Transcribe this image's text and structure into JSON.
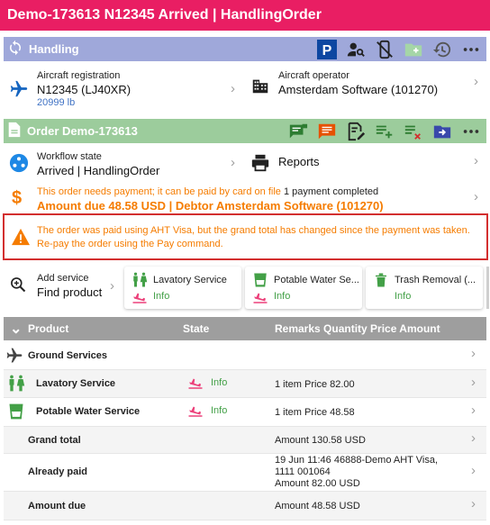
{
  "title": "Demo-173613 N12345 Arrived | HandlingOrder",
  "handling": {
    "header": "Handling",
    "aircraft_registration_label": "Aircraft registration",
    "aircraft_registration": "N12345 (LJ40XR)",
    "aircraft_weight": "20999 lb",
    "aircraft_operator_label": "Aircraft operator",
    "aircraft_operator": "Amsterdam Software (101270)"
  },
  "order": {
    "header": "Order Demo-173613",
    "workflow_label": "Workflow state",
    "workflow_value": "Arrived | HandlingOrder",
    "reports_label": "Reports",
    "payment_note": "This order needs payment; it can be paid by card on file",
    "payment_count": "1 payment completed",
    "amount_due_line": "Amount due 48.58 USD | Debtor Amsterdam Software (101270)"
  },
  "warning": "The order was paid using AHT Visa, but the grand total has changed since the payment was taken. Re-pay the order using the Pay command.",
  "add_service": {
    "label": "Add service",
    "value": "Find product"
  },
  "service_cards": [
    {
      "title": "Lavatory Service",
      "status": "Info"
    },
    {
      "title": "Potable Water Se...",
      "status": "Info"
    },
    {
      "title": "Trash Removal (...",
      "status": "Info"
    }
  ],
  "table": {
    "columns": [
      "Product",
      "State",
      "Remarks Quantity Price Amount"
    ],
    "group": "Ground Services",
    "rows": [
      {
        "name": "Lavatory Service",
        "state": "Info",
        "details": "1 item Price 82.00"
      },
      {
        "name": "Potable Water Service",
        "state": "Info",
        "details": "1 item Price 48.58"
      }
    ],
    "grand_total": {
      "label": "Grand total",
      "value": "Amount 130.58 USD"
    },
    "already_paid": {
      "label": "Already paid",
      "line1": "19 Jun 11:46 46888-Demo AHT Visa,",
      "line2": "1111 001064",
      "line3": "Amount 82.00 USD"
    },
    "amount_due": {
      "label": "Amount due",
      "value": "Amount 48.58 USD"
    }
  },
  "colors": {
    "titlebar": "#e91e63",
    "handling": "#9fa8da",
    "order": "#9ccc9c",
    "warning": "#f57c00",
    "info": "#43a047",
    "alert_border": "#d32f2f"
  }
}
